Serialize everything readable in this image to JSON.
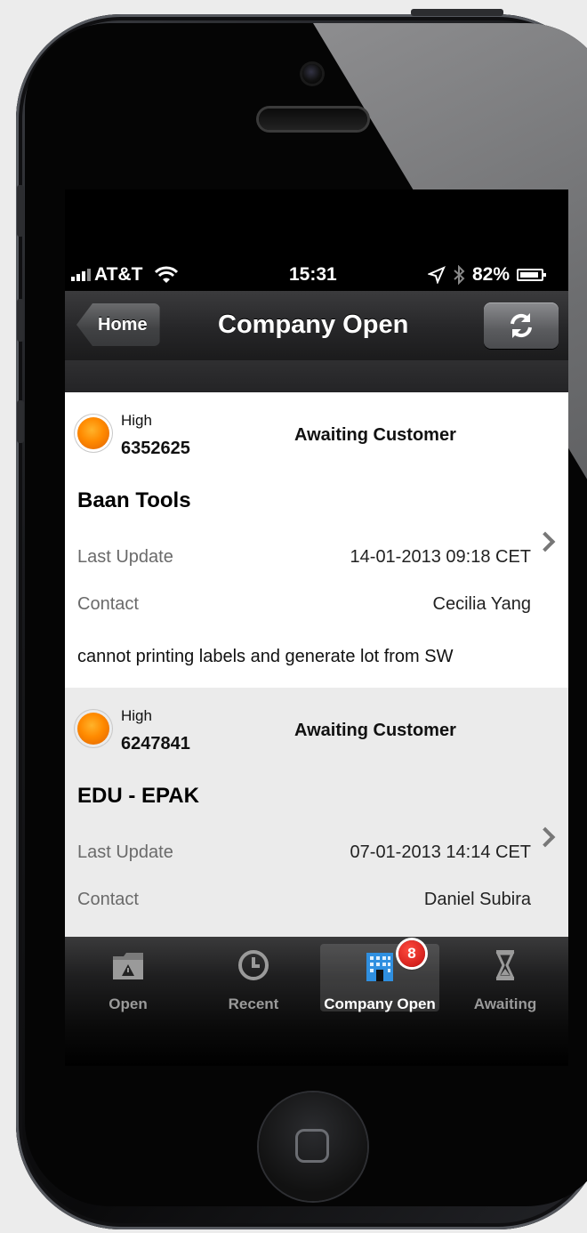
{
  "status_bar": {
    "carrier": "AT&T",
    "time": "15:31",
    "battery": "82%",
    "icons": [
      "signal-icon",
      "wifi-icon",
      "location-icon",
      "bluetooth-icon",
      "battery-icon"
    ]
  },
  "nav": {
    "title": "Company Open",
    "back_label": "Home",
    "refresh_icon": "refresh-icon"
  },
  "tickets": [
    {
      "priority": "High",
      "id": "6352625",
      "status": "Awaiting Customer",
      "company": "Baan Tools",
      "last_update_label": "Last Update",
      "last_update": "14-01-2013 09:18 CET",
      "contact_label": "Contact",
      "contact": "Cecilia Yang",
      "description": "cannot printing labels and generate lot from SW"
    },
    {
      "priority": "High",
      "id": "6247841",
      "status": "Awaiting Customer",
      "company": "EDU - EPAK",
      "last_update_label": "Last Update",
      "last_update": "07-01-2013 14:14 CET",
      "contact_label": "Contact",
      "contact": "Daniel Subira"
    }
  ],
  "tab_bar": {
    "tabs": [
      {
        "label": "Open",
        "icon": "folder-warning-icon"
      },
      {
        "label": "Recent",
        "icon": "clock-icon"
      },
      {
        "label": "Company Open",
        "icon": "building-icon",
        "badge": "8",
        "selected": true
      },
      {
        "label": "Awaiting",
        "icon": "hourglass-icon"
      }
    ]
  },
  "colors": {
    "priority_high": "#ff8a00",
    "badge": "#d61a14",
    "nav_bar": "#262628"
  }
}
